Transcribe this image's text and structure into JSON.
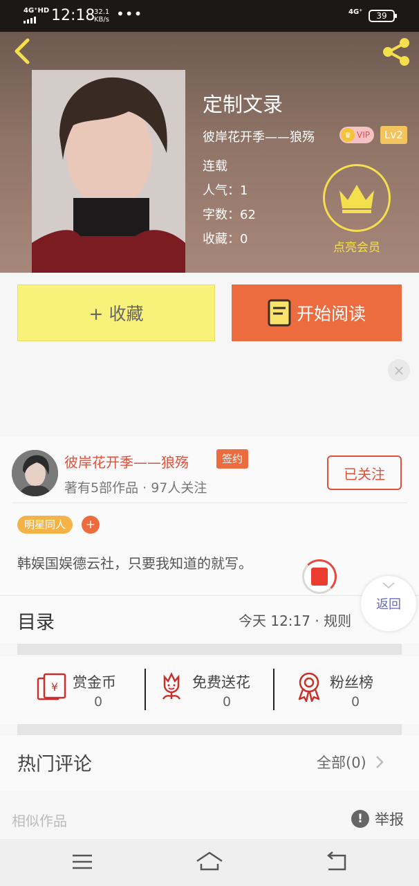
{
  "status_bar": {
    "network_left": "4G⁺HD",
    "time": "12:18",
    "speed_value": "32.1",
    "speed_unit": "KB/s",
    "more": "•••",
    "network_right": "4G⁺",
    "battery": "39"
  },
  "book": {
    "title": "定制文录",
    "author_line": "彼岸花开季——狼殇",
    "vip_label": "VIP",
    "level": "Lv2",
    "status": "连载",
    "popularity": "人气：1",
    "word_count": "字数：62",
    "favorites": "收藏：0",
    "member_label": "点亮会员"
  },
  "actions": {
    "collect_label": "+ 收藏",
    "read_label": "开始阅读"
  },
  "ad": {
    "close_glyph": "×"
  },
  "author": {
    "name": "彼岸花开季——狼殇",
    "sign_badge": "签约",
    "stats": "著有5部作品 · 97人关注",
    "follow_label": "已关注",
    "tag": "明星同人",
    "tag_add": "+",
    "description": "韩娱国娱德云社，只要我知道的就写。"
  },
  "toc": {
    "label": "目录",
    "update_info": "今天 12:17 · 规则",
    "float_back": "返回"
  },
  "rewards": [
    {
      "name": "赏金币",
      "value": "0",
      "icon": "coin-envelope-icon"
    },
    {
      "name": "免费送花",
      "value": "0",
      "icon": "flower-icon"
    },
    {
      "name": "粉丝榜",
      "value": "0",
      "icon": "ribbon-medal-icon"
    }
  ],
  "comments": {
    "label": "热门评论",
    "all_label": "全部(0)"
  },
  "footer": {
    "similar_label": "相似作品",
    "report_glyph": "!",
    "report_label": "举报"
  },
  "colors": {
    "accent_orange": "#ec6c40",
    "accent_red": "#e0503a",
    "collect_yellow": "#f8f17a",
    "member_gold": "#f4e04d"
  }
}
